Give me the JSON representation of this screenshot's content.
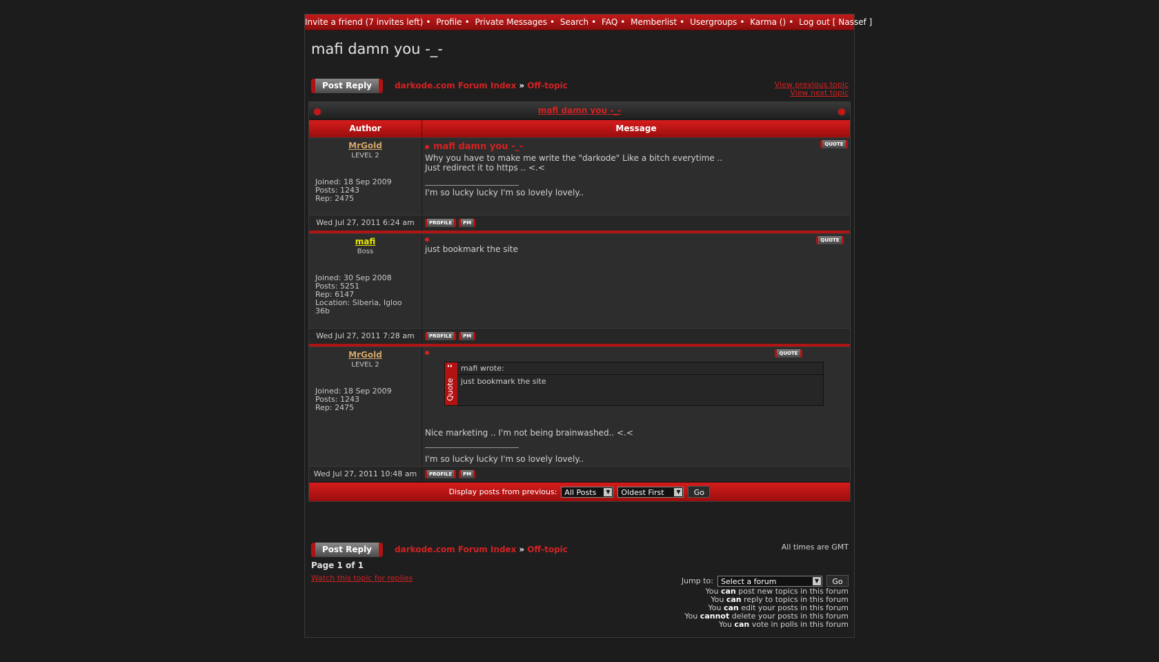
{
  "topbar": {
    "items": [
      "Invite a friend (7 invites left)",
      "Profile",
      "Private Messages",
      "Search",
      "FAQ",
      "Memberlist",
      "Usergroups",
      "Karma ()",
      "Log out [ Nassef ]"
    ]
  },
  "page_title": "mafi damn you -_-",
  "post_reply_label": "Post Reply",
  "breadcrumb": {
    "forum_index": "darkode.com Forum Index",
    "raquo": "»",
    "subforum": "Off-topic"
  },
  "topic_nav": {
    "previous": "View previous topic",
    "next": "View next topic"
  },
  "table": {
    "title": "mafi damn you -_-",
    "col_author": "Author",
    "col_message": "Message"
  },
  "posts": [
    {
      "username": "MrGold",
      "rank": "LEVEL 2",
      "joined": "Joined: 18 Sep 2009",
      "posts": "Posts: 1243",
      "rep": "Rep: 2475",
      "subject": "mafi damn you -_-",
      "text": "Why you have to make me write the \"darkode\" Like a bitch everytime ..\nJust redirect it to https .. <.<",
      "signature": "I'm so lucky lucky I'm so lovely lovely..",
      "time": "Wed Jul 27, 2011 6:24 am"
    },
    {
      "username": "mafi",
      "rank": "Boss",
      "joined": "Joined: 30 Sep 2008",
      "posts": "Posts: 5251",
      "rep": "Rep: 6147",
      "location": "Location: Siberia, Igloo 36b",
      "text": "just bookmark the site",
      "time": "Wed Jul 27, 2011 7:28 am"
    },
    {
      "username": "MrGold",
      "rank": "LEVEL 2",
      "joined": "Joined: 18 Sep 2009",
      "posts": "Posts: 1243",
      "rep": "Rep: 2475",
      "quote_author": "mafi wrote:",
      "quote_text": "just bookmark the site",
      "quote_label": "Quote",
      "text": "Nice marketing .. I'm not being brainwashed.. <.<",
      "signature": "I'm so lucky lucky I'm so lovely lovely..",
      "time": "Wed Jul 27, 2011 10:48 am"
    }
  ],
  "buttons": {
    "quote": "QUOTE",
    "profile": "PROFILE",
    "pm": "PM"
  },
  "display": {
    "label": "Display posts from previous:",
    "range": "All Posts",
    "order": "Oldest First",
    "go": "Go"
  },
  "all_times": "All times are GMT",
  "page_number": "Page 1 of 1",
  "watch_topic": "Watch this topic for replies",
  "jump": {
    "label": "Jump to:",
    "select": "Select a forum",
    "go": "Go"
  },
  "permissions": [
    {
      "pre": "You ",
      "bold": "can",
      "post": " post new topics in this forum"
    },
    {
      "pre": "You ",
      "bold": "can",
      "post": " reply to topics in this forum"
    },
    {
      "pre": "You ",
      "bold": "can",
      "post": " edit your posts in this forum"
    },
    {
      "pre": "You ",
      "bold": "cannot",
      "post": " delete your posts in this forum"
    },
    {
      "pre": "You ",
      "bold": "can",
      "post": " vote in polls in this forum"
    }
  ],
  "colors": {
    "accent": "#c41a1a",
    "link": "#d42222",
    "gold_user": "#d4a86a",
    "boss_user": "#e8e800"
  }
}
